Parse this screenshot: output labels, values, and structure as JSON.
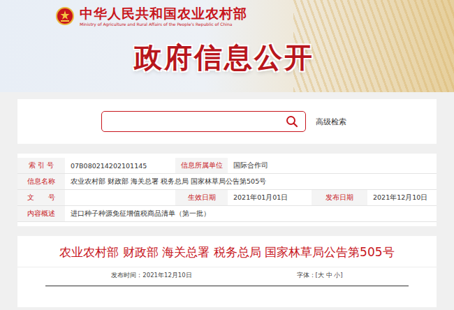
{
  "header": {
    "ministry": "中华人民共和国农业农村部",
    "ministry_en": "Ministry of Agriculture and Rural Affairs of the People's Republic of China",
    "banner": "政府信息公开"
  },
  "search": {
    "placeholder": "",
    "advanced": "高级检索"
  },
  "info_table": {
    "rows": [
      [
        {
          "label": "索 引 号",
          "value": "07B080214202101145"
        },
        {
          "label": "信息所属单位",
          "value": "国际合作司"
        }
      ],
      [
        {
          "label": "信息名称",
          "value": "农业农村部 财政部 海关总署 税务总局 国家林草局公告第505号"
        }
      ],
      [
        {
          "label": "文　　号",
          "value": ""
        },
        {
          "label": "生效日期",
          "value": "2021年01月01日"
        },
        {
          "label": "发布日期",
          "value": "2021年12月10日"
        }
      ],
      [
        {
          "label": "内容概述",
          "value": "进口种子种源免征增值税商品清单（第一批）"
        }
      ]
    ]
  },
  "article": {
    "title": "农业农村部 财政部 海关总署 税务总局 国家林草局公告第505号",
    "published": "发布时间：2021年12月10日",
    "font_size": "字体：[大 中 小]"
  }
}
